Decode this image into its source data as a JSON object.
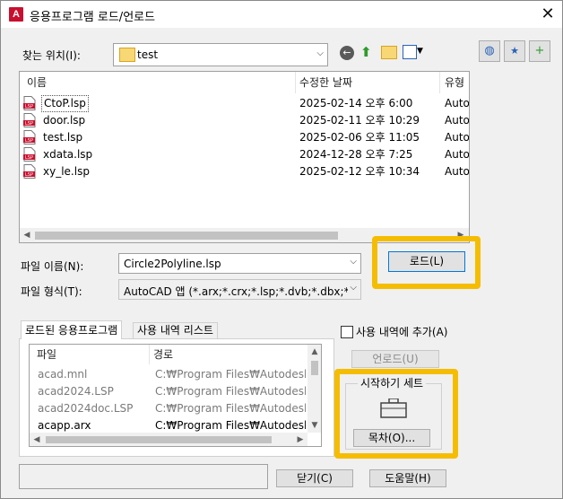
{
  "window": {
    "title": "응용프로그램 로드/언로드",
    "app_icon": "A"
  },
  "location": {
    "label": "찾는 위치(I):",
    "value": "test"
  },
  "file_list": {
    "columns": [
      "이름",
      "수정한 날짜",
      "유형"
    ],
    "rows": [
      {
        "name": "CtoP.lsp",
        "date": "2025-02-14 오후 6:00",
        "type": "Auto"
      },
      {
        "name": "door.lsp",
        "date": "2025-02-11 오후 10:29",
        "type": "Auto"
      },
      {
        "name": "test.lsp",
        "date": "2025-02-06 오후 11:05",
        "type": "Auto"
      },
      {
        "name": "xdata.lsp",
        "date": "2024-12-28 오후 7:25",
        "type": "Auto"
      },
      {
        "name": "xy_le.lsp",
        "date": "2025-02-12 오후 10:34",
        "type": "Auto"
      }
    ]
  },
  "filename": {
    "label": "파일 이름(N):",
    "value": "Circle2Polyline.lsp"
  },
  "filetype": {
    "label": "파일 형식(T):",
    "value": "AutoCAD 앱 (*.arx;*.crx;*.lsp;*.dvb;*.dbx;*.vlx;*"
  },
  "load_button": "로드(L)",
  "tabs": [
    "로드된 응용프로그램",
    "사용 내역 리스트"
  ],
  "add_history": "사용 내역에 추가(A)",
  "unload_button": "언로드(U)",
  "loaded_apps": {
    "columns": [
      "파일",
      "경로"
    ],
    "rows": [
      {
        "file": "acad.mnl",
        "path": "C:₩Program Files₩Autodesk₩",
        "grey": true
      },
      {
        "file": "acad2024.LSP",
        "path": "C:₩Program Files₩Autodesk₩",
        "grey": true
      },
      {
        "file": "acad2024doc.LSP",
        "path": "C:₩Program Files₩Autodesk₩",
        "grey": true
      },
      {
        "file": "acapp.arx",
        "path": "C:₩Program Files₩Autodesk₩",
        "grey": false
      }
    ]
  },
  "startup_suite": {
    "title": "시작하기 세트",
    "contents_button": "목차(O)..."
  },
  "close_button": "닫기(C)",
  "help_button": "도움말(H)",
  "colors": {
    "highlight": "#f5bd02",
    "lsp_icon": "#c8102e"
  }
}
